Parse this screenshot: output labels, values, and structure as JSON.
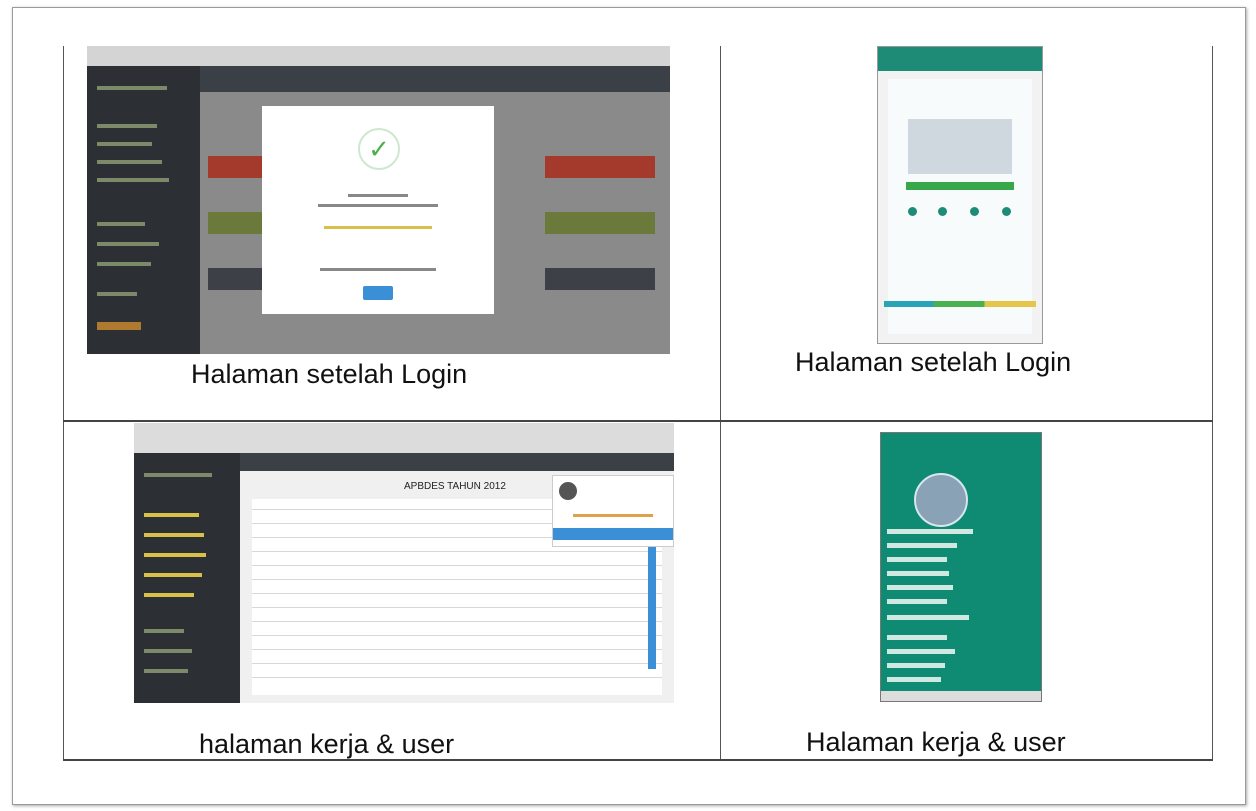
{
  "cells": {
    "top_left_caption": "Halaman setelah Login",
    "top_right_caption": "Halaman setelah Login",
    "bottom_left_caption": "halaman kerja & user",
    "bottom_right_caption": "Halaman kerja & user"
  },
  "screens": {
    "desktop_table_title": "APBDES TAHUN 2012",
    "check_icon": "check-icon",
    "accent_colors": {
      "green": "#1e8b77",
      "red_block": "#a33a2c",
      "olive_block": "#6b7a3a",
      "modal_button": "#3a8fd6"
    }
  }
}
